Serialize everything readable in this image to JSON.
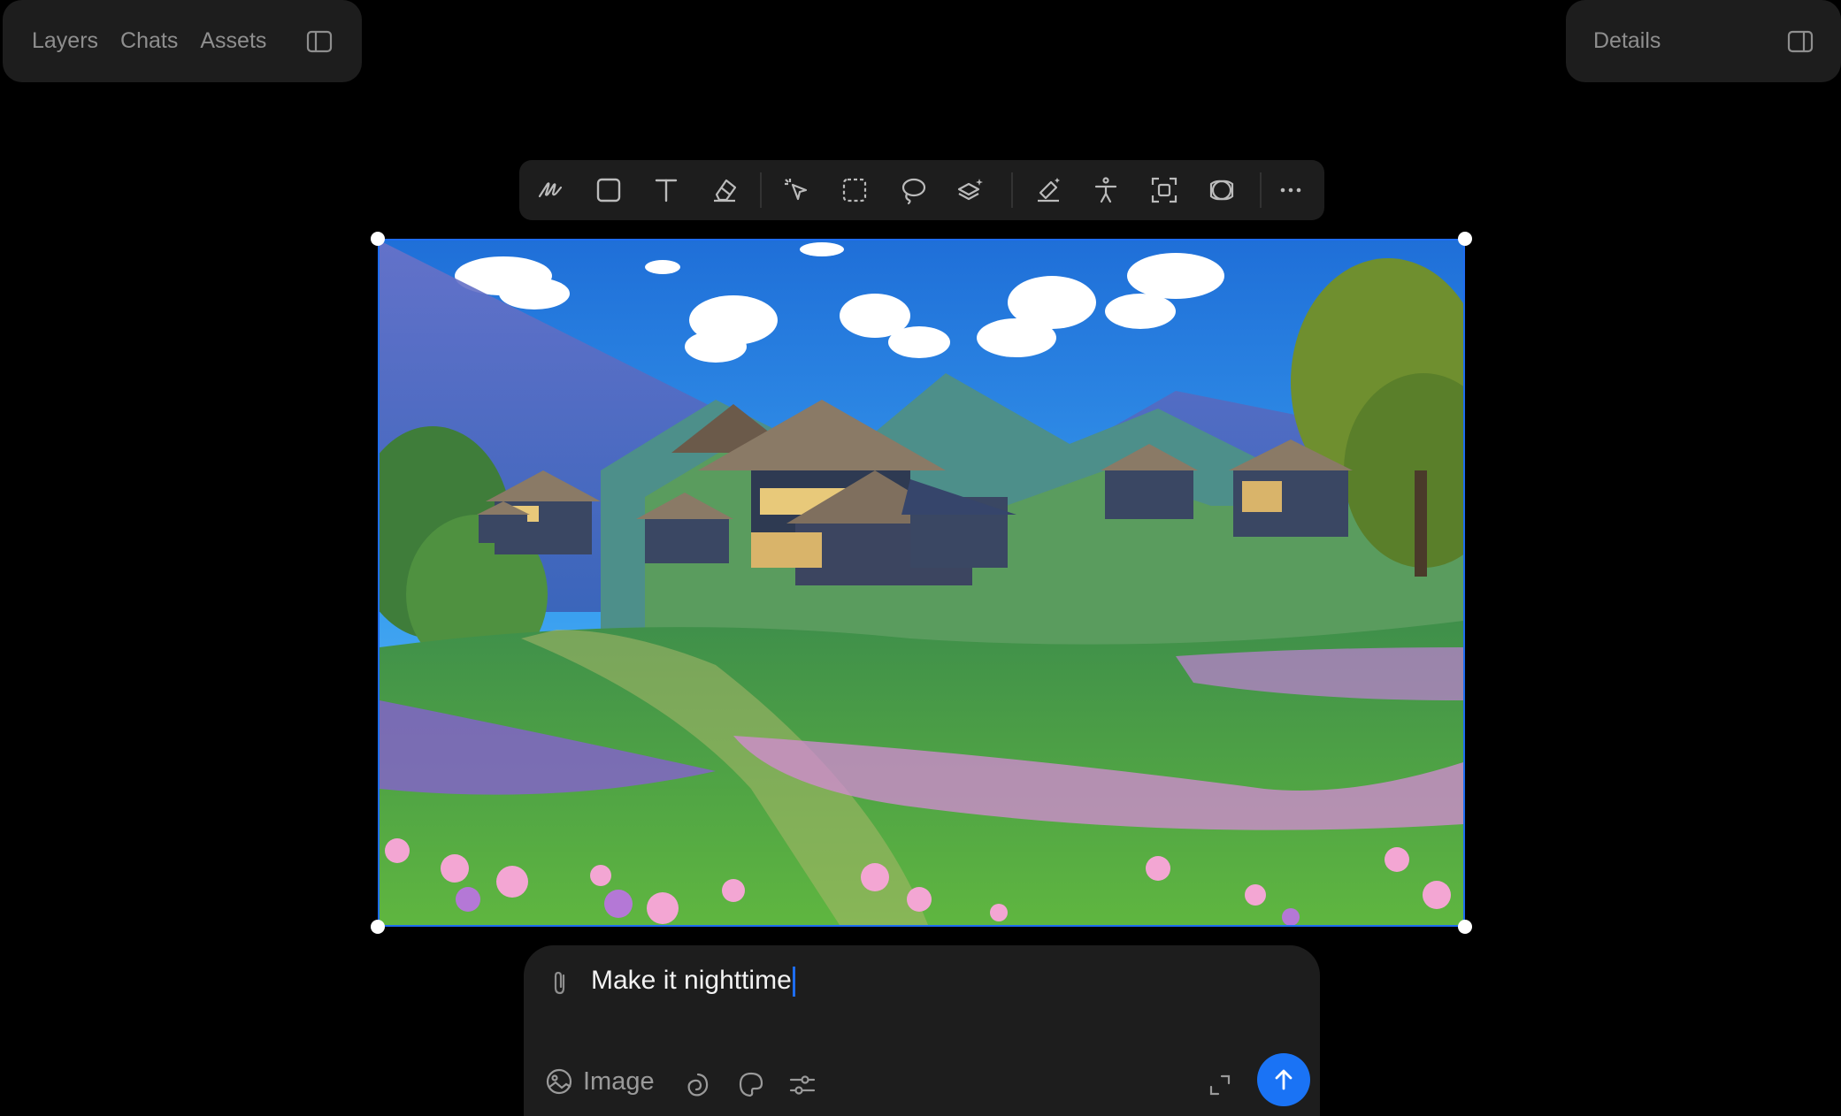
{
  "left_panel": {
    "tabs": [
      "Layers",
      "Chats",
      "Assets"
    ],
    "toggle_icon": "sidebar-left-icon"
  },
  "right_panel": {
    "title": "Details",
    "toggle_icon": "sidebar-right-icon"
  },
  "toolbar": {
    "tools": [
      "draw-icon",
      "rectangle-icon",
      "text-icon",
      "eraser-icon",
      "smart-select-icon",
      "marquee-select-icon",
      "lasso-icon",
      "layers-magic-icon",
      "brush-magic-icon",
      "pose-icon",
      "crop-focus-icon",
      "remove-background-icon",
      "more-icon"
    ]
  },
  "prompt": {
    "value": "Make it nighttime",
    "mode_label": "Image",
    "accent": "#1a73f5"
  },
  "selection_color": "#1e6df0"
}
